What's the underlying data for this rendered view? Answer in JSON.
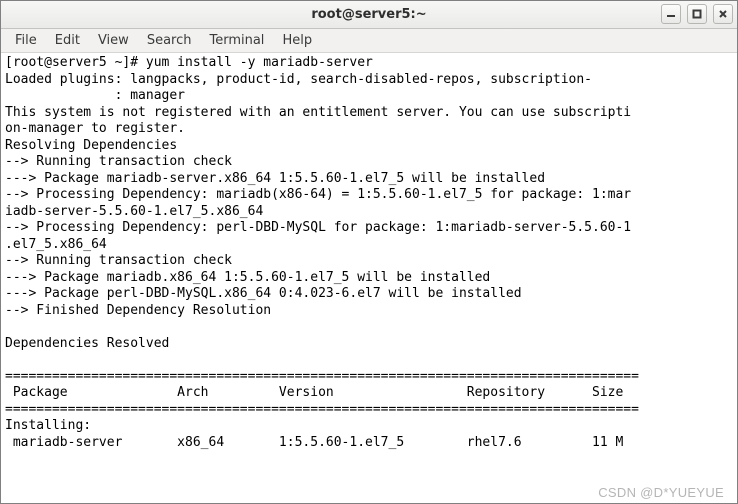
{
  "window": {
    "title": "root@server5:~"
  },
  "menu": {
    "file": "File",
    "edit": "Edit",
    "view": "View",
    "search": "Search",
    "terminal": "Terminal",
    "help": "Help"
  },
  "terminal": {
    "content": "[root@server5 ~]# yum install -y mariadb-server\nLoaded plugins: langpacks, product-id, search-disabled-repos, subscription-\n              : manager\nThis system is not registered with an entitlement server. You can use subscripti\non-manager to register.\nResolving Dependencies\n--> Running transaction check\n---> Package mariadb-server.x86_64 1:5.5.60-1.el7_5 will be installed\n--> Processing Dependency: mariadb(x86-64) = 1:5.5.60-1.el7_5 for package: 1:mar\niadb-server-5.5.60-1.el7_5.x86_64\n--> Processing Dependency: perl-DBD-MySQL for package: 1:mariadb-server-5.5.60-1\n.el7_5.x86_64\n--> Running transaction check\n---> Package mariadb.x86_64 1:5.5.60-1.el7_5 will be installed\n---> Package perl-DBD-MySQL.x86_64 0:4.023-6.el7 will be installed\n--> Finished Dependency Resolution\n\nDependencies Resolved\n\n=================================================================================\n Package              Arch         Version                 Repository      Size\n=================================================================================\nInstalling:\n mariadb-server       x86_64       1:5.5.60-1.el7_5        rhel7.6         11 M"
  },
  "watermark": "CSDN @D*YUEYUE"
}
